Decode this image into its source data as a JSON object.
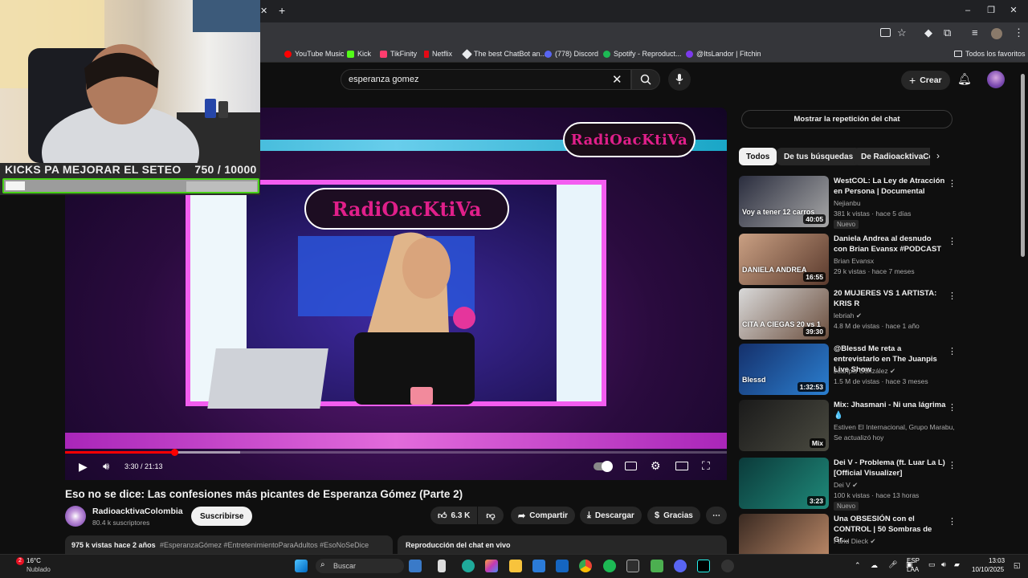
{
  "browser": {
    "bookmarks": [
      "YouTube Music",
      "Kick",
      "TikFinity",
      "Netflix",
      "The best ChatBot an...",
      "(778) Discord",
      "Spotify - Reproduct...",
      "@ItsLandor | Fitchin"
    ],
    "all_bookmarks": "Todos los favoritos"
  },
  "overlay": {
    "goal_label": "KICKS PA MEJORAR EL SETEO",
    "goal_progress": "750  /  10000",
    "goal_fraction": 0.075
  },
  "masthead": {
    "search_value": "esperanza gomez",
    "create_label": "Crear"
  },
  "player": {
    "time": "3:30 / 21:13",
    "progress_fraction": 0.165,
    "channel_logo_text": "RadiOacKtiVa"
  },
  "video": {
    "title": "Eso no se dice: Las confesiones más picantes de Esperanza Gómez (Parte 2)",
    "channel": "RadioacktivaColombia",
    "subscribers": "80.4 k suscriptores",
    "subscribe": "Suscribirse",
    "likes": "6.3 K",
    "share": "Compartir",
    "download": "Descargar",
    "thanks": "Gracias",
    "desc_views": "975 k vistas  hace 2 años",
    "desc_tags": "#EsperanzaGómez #EntretenimientoParaAdultos #EsoNoSeDice",
    "chat_replay_header": "Reproducción del chat en vivo"
  },
  "sidebar": {
    "show_chat": "Mostrar la repetición del chat",
    "chips": [
      "Todos",
      "De tus búsquedas",
      "De RadioacktivaCol"
    ],
    "items": [
      {
        "title": "WestCOL: La Ley de Atracción en Persona | Documental",
        "channel": "Nejianbu",
        "meta": "381 k vistas · hace 5 días",
        "badge": "Nuevo",
        "duration": "40:05",
        "thumb_text": "Voy a tener 12 carros",
        "c1": "#2a2d3e",
        "c2": "#a8a8a8"
      },
      {
        "title": "Daniela Andrea al desnudo con Brian Evansx #PODCAST",
        "channel": "Brian Evansx",
        "meta": "29 k vistas · hace 7 meses",
        "badge": "",
        "duration": "16:55",
        "thumb_text": "DANIELA ANDREA",
        "c1": "#caa083",
        "c2": "#5a3a2d"
      },
      {
        "title": "20 MUJERES VS 1 ARTISTA: KRIS R",
        "channel": "lebriah ✔",
        "meta": "4.8 M de vistas · hace 1 año",
        "badge": "",
        "duration": "39:30",
        "thumb_text": "CITA A CIEGAS 20 vs 1",
        "c1": "#d9d9d9",
        "c2": "#6b4e3d"
      },
      {
        "title": "@Blessd Me reta a entrevistarlo en The Juanpis Live Show",
        "channel": "Juanpis González ✔",
        "meta": "1.5 M de vistas · hace 3 meses",
        "badge": "",
        "duration": "1:32:53",
        "thumb_text": "Blessd",
        "c1": "#15306b",
        "c2": "#2b7fd0"
      },
      {
        "title": "Mix: Jhasmani - Ni una lágrima 💧",
        "channel": "Estiven El Internacional, Grupo Marabu, E...",
        "meta": "Se actualizó hoy",
        "badge": "",
        "duration": "Mix",
        "thumb_text": "",
        "c1": "#1a1a1a",
        "c2": "#4a4a40"
      },
      {
        "title": "Dei V - Problema (ft. Luar La L) [Official Visualizer]",
        "channel": "Dei V ✔",
        "meta": "100 k vistas · hace 13 horas",
        "badge": "Nuevo",
        "duration": "3:23",
        "thumb_text": "",
        "c1": "#0b3a3a",
        "c2": "#1f8a7a"
      },
      {
        "title": "Una OBSESIÓN con el CONTROL | 50 Sombras de Gr...",
        "channel": "Farid Dieck ✔",
        "meta": "",
        "badge": "",
        "duration": "",
        "thumb_text": "",
        "c1": "#3a2a22",
        "c2": "#c08c6a"
      }
    ]
  },
  "taskbar": {
    "weather_temp": "16°C",
    "weather_desc": "Nublado",
    "weather_badge": "2",
    "search": "Buscar",
    "lang1": "ESP",
    "lang2": "LAA",
    "time": "13:03",
    "date": "10/10/2025"
  }
}
